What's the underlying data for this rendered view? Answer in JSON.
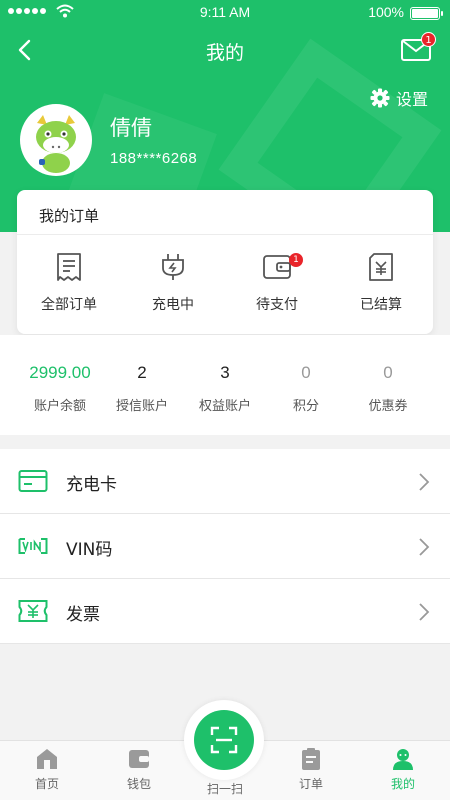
{
  "status_bar": {
    "time": "9:11 AM",
    "battery": "100%"
  },
  "nav": {
    "title": "我的",
    "mail_badge": "1"
  },
  "profile": {
    "settings_label": "设置",
    "name": "倩倩",
    "phone": "188****6268"
  },
  "orders": {
    "title": "我的订单",
    "items": [
      {
        "label": "全部订单",
        "icon": "document-icon"
      },
      {
        "label": "充电中",
        "icon": "plug-icon"
      },
      {
        "label": "待支付",
        "icon": "wallet-icon",
        "badge": "1"
      },
      {
        "label": "已结算",
        "icon": "yuan-receipt-icon"
      }
    ]
  },
  "stats": [
    {
      "value": "2999.00",
      "label": "账户余额"
    },
    {
      "value": "2",
      "label": "授信账户"
    },
    {
      "value": "3",
      "label": "权益账户"
    },
    {
      "value": "0",
      "label": "积分"
    },
    {
      "value": "0",
      "label": "优惠券"
    }
  ],
  "menu": [
    {
      "label": "充电卡",
      "icon": "card-icon"
    },
    {
      "label": "VIN码",
      "icon": "vin-icon"
    },
    {
      "label": "发票",
      "icon": "ticket-yuan-icon"
    }
  ],
  "tabs": [
    {
      "label": "首页",
      "icon": "home-icon"
    },
    {
      "label": "钱包",
      "icon": "wallet-icon"
    },
    {
      "label": "扫一扫",
      "icon": "scan-icon"
    },
    {
      "label": "订单",
      "icon": "clipboard-icon"
    },
    {
      "label": "我的",
      "icon": "user-icon",
      "active": true
    }
  ],
  "colors": {
    "brand": "#1ec06a",
    "badge": "#e9242a"
  }
}
